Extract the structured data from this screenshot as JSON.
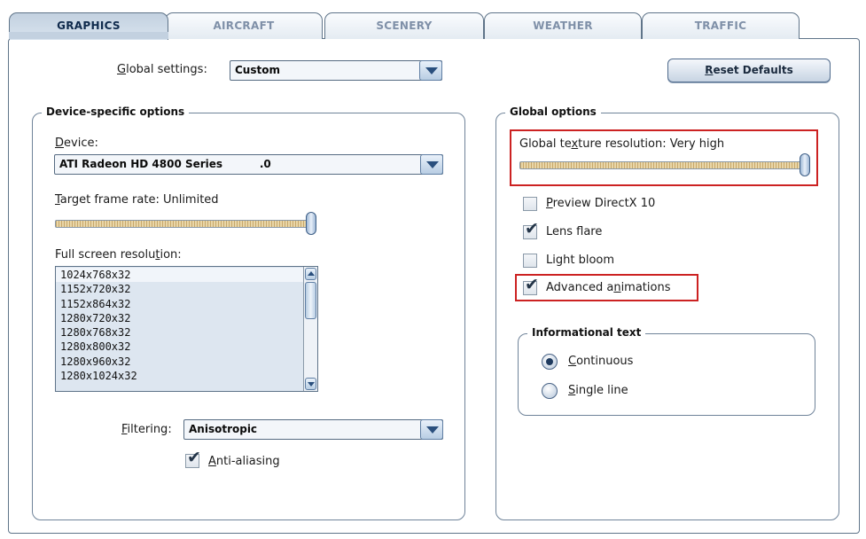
{
  "tabs": [
    {
      "label": "GRAPHICS",
      "active": true
    },
    {
      "label": "AIRCRAFT",
      "active": false
    },
    {
      "label": "SCENERY",
      "active": false
    },
    {
      "label": "WEATHER",
      "active": false
    },
    {
      "label": "TRAFFIC",
      "active": false
    }
  ],
  "global_settings": {
    "label_pre": "",
    "label_key": "G",
    "label_post": "lobal settings:",
    "value": "Custom"
  },
  "reset_button": {
    "key": "R",
    "rest": "eset Defaults"
  },
  "device_group": {
    "legend": "Device-specific options",
    "device": {
      "label_key": "D",
      "label_post": "evice:",
      "value": "ATI Radeon HD 4800 Series          .0"
    },
    "frame_rate": {
      "label_key": "T",
      "label_post": "arget frame rate: Unlimited",
      "level": 1.0
    },
    "resolution": {
      "label_pre": "Full screen resolu",
      "label_key": "t",
      "label_post": "ion:",
      "items": [
        "1024x768x32",
        "1152x720x32",
        "1152x864x32",
        "1280x720x32",
        "1280x768x32",
        "1280x800x32",
        "1280x960x32",
        "1280x1024x32"
      ],
      "selected": "1024x768x32"
    },
    "filtering": {
      "label_key": "F",
      "label_post": "iltering:",
      "value": "Anisotropic"
    },
    "anti_aliasing": {
      "label_key": "A",
      "label_post": "nti-aliasing",
      "checked": true
    }
  },
  "global_group": {
    "legend": "Global options",
    "texture": {
      "label_pre": "Global te",
      "label_key": "x",
      "label_post": "ture resolution: Very high",
      "level": 1.0
    },
    "options": [
      {
        "key": "P",
        "post": "review DirectX 10",
        "pre": "",
        "checked": false
      },
      {
        "key": "",
        "post": "Lens flare",
        "pre": "",
        "checked": true
      },
      {
        "key": "",
        "post": "Light bloom",
        "pre": "",
        "checked": false
      },
      {
        "key": "n",
        "post": "imations",
        "pre": "Advanced a",
        "checked": true
      }
    ],
    "info_text": {
      "legend": "Informational text",
      "choices": [
        {
          "key": "C",
          "post": "ontinuous",
          "selected": true
        },
        {
          "key": "S",
          "post": "ingle line",
          "selected": false
        }
      ]
    }
  },
  "colors": {
    "highlight": "#cc2222",
    "tab_active_text": "#0f2a4c",
    "tab_inactive_text": "#7f90a8"
  }
}
